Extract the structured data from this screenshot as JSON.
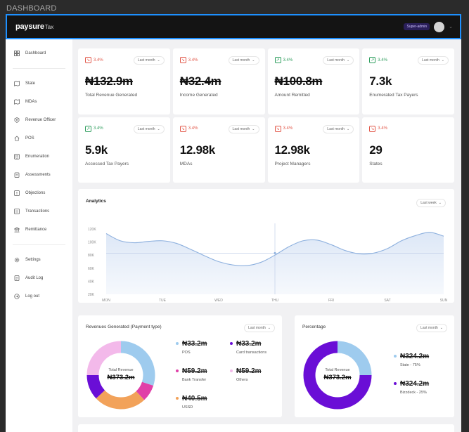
{
  "canvas_label": "DASHBOARD",
  "header": {
    "logo_main": "paysure",
    "logo_sub": "Tax",
    "role_badge": "Super-admin"
  },
  "sidebar": {
    "items": [
      {
        "label": "Dashboard",
        "icon": "grid-icon"
      },
      {
        "label": "State",
        "icon": "map-icon"
      },
      {
        "label": "MDAs",
        "icon": "map-icon"
      },
      {
        "label": "Revenue Officer",
        "icon": "badge-icon"
      },
      {
        "label": "POS",
        "icon": "home-icon"
      },
      {
        "label": "Enumeration",
        "icon": "people-icon"
      },
      {
        "label": "Assessments",
        "icon": "clipboard-icon"
      },
      {
        "label": "Objections",
        "icon": "alert-icon"
      },
      {
        "label": "Transactions",
        "icon": "list-icon"
      },
      {
        "label": "Remittance",
        "icon": "bank-icon"
      },
      {
        "label": "Settings",
        "icon": "gear-icon"
      },
      {
        "label": "Audit Log",
        "icon": "log-icon"
      },
      {
        "label": "Log out",
        "icon": "logout-icon"
      }
    ]
  },
  "stats": [
    {
      "trend": "3.4%",
      "direction": "down",
      "period": "Last month",
      "value": "₦132.9m",
      "struck": true,
      "label": "Total Revenue Generated"
    },
    {
      "trend": "3.4%",
      "direction": "down",
      "period": "Last month",
      "value": "₦32.4m",
      "struck": true,
      "label": "Income Generated"
    },
    {
      "trend": "3.4%",
      "direction": "up",
      "period": "Last month",
      "value": "₦100.8m",
      "struck": true,
      "label": "Amount Remitted"
    },
    {
      "trend": "3.4%",
      "direction": "up",
      "period": "Last month",
      "value": "7.3k",
      "struck": false,
      "label": "Enumerated Tax Payers"
    },
    {
      "trend": "3.4%",
      "direction": "up",
      "period": "Last month",
      "value": "5.9k",
      "struck": false,
      "label": "Accessed Tax Payers"
    },
    {
      "trend": "3.4%",
      "direction": "down",
      "period": "Last month",
      "value": "12.98k",
      "struck": false,
      "label": "MDAs"
    },
    {
      "trend": "3.4%",
      "direction": "down",
      "period": "Last month",
      "value": "12.98k",
      "struck": false,
      "label": "Project Managers"
    },
    {
      "trend": "3.4%",
      "direction": "down",
      "period": "",
      "value": "29",
      "struck": false,
      "label": "States"
    }
  ],
  "analytics": {
    "title": "Analytics",
    "period": "Last week"
  },
  "chart_data": {
    "type": "area",
    "title": "",
    "xlabel": "",
    "ylabel": "",
    "categories": [
      "MON",
      "TUE",
      "WED",
      "THU",
      "FRI",
      "SAT",
      "SUN"
    ],
    "y_ticks": [
      "120K",
      "100K",
      "80K",
      "60K",
      "40K",
      "20K"
    ],
    "ylim": [
      20000,
      120000
    ],
    "x": [
      0,
      0.25,
      0.5,
      0.75,
      1.0,
      1.25,
      1.5,
      1.75,
      2.0,
      2.25,
      2.5,
      2.75,
      3.0,
      3.25,
      3.5,
      3.75,
      4.0,
      4.25,
      4.5,
      4.75,
      5.0,
      5.25,
      5.5,
      5.75,
      6.0
    ],
    "values": [
      113000,
      102000,
      99000,
      101000,
      102000,
      98000,
      89000,
      79000,
      70000,
      65000,
      64000,
      69000,
      80000,
      93000,
      102000,
      103000,
      96000,
      87000,
      82000,
      83000,
      90000,
      102000,
      110000,
      115000,
      109000
    ],
    "reference_line": 83000,
    "highlight_x": "THU",
    "grid": false,
    "fill_color": "#dbe6f6",
    "line_color": "#8db0de"
  },
  "revenue": {
    "title": "Revenues Generated (Payment type)",
    "period": "Last month",
    "center_label": "Total Revenue",
    "center_value": "₦373.2m",
    "slices": [
      {
        "label": "POS",
        "value": "₦33.2m",
        "share": 0.3,
        "color": "#9ecbee"
      },
      {
        "label": "Bank Transfer",
        "value": "₦59.2m",
        "share": 0.08,
        "color": "#e040a8"
      },
      {
        "label": "USSD",
        "value": "₦40.5m",
        "share": 0.25,
        "color": "#f2a25a"
      },
      {
        "label": "Card transactions",
        "value": "₦33.2m",
        "share": 0.12,
        "color": "#6a0ed6"
      },
      {
        "label": "Others",
        "value": "₦59.2m",
        "share": 0.25,
        "color": "#f3b9ea"
      }
    ]
  },
  "percentage": {
    "title": "Percentage",
    "period": "Last month",
    "center_label": "Total Revenue",
    "center_value": "₦373.2m",
    "slices": [
      {
        "label": "State - 75%",
        "value": "₦324.2m",
        "share": 0.25,
        "color": "#9ecbee"
      },
      {
        "label": "Bizzdeck - 25%",
        "value": "₦324.2m",
        "share": 0.75,
        "color": "#6a0ed6"
      }
    ]
  }
}
